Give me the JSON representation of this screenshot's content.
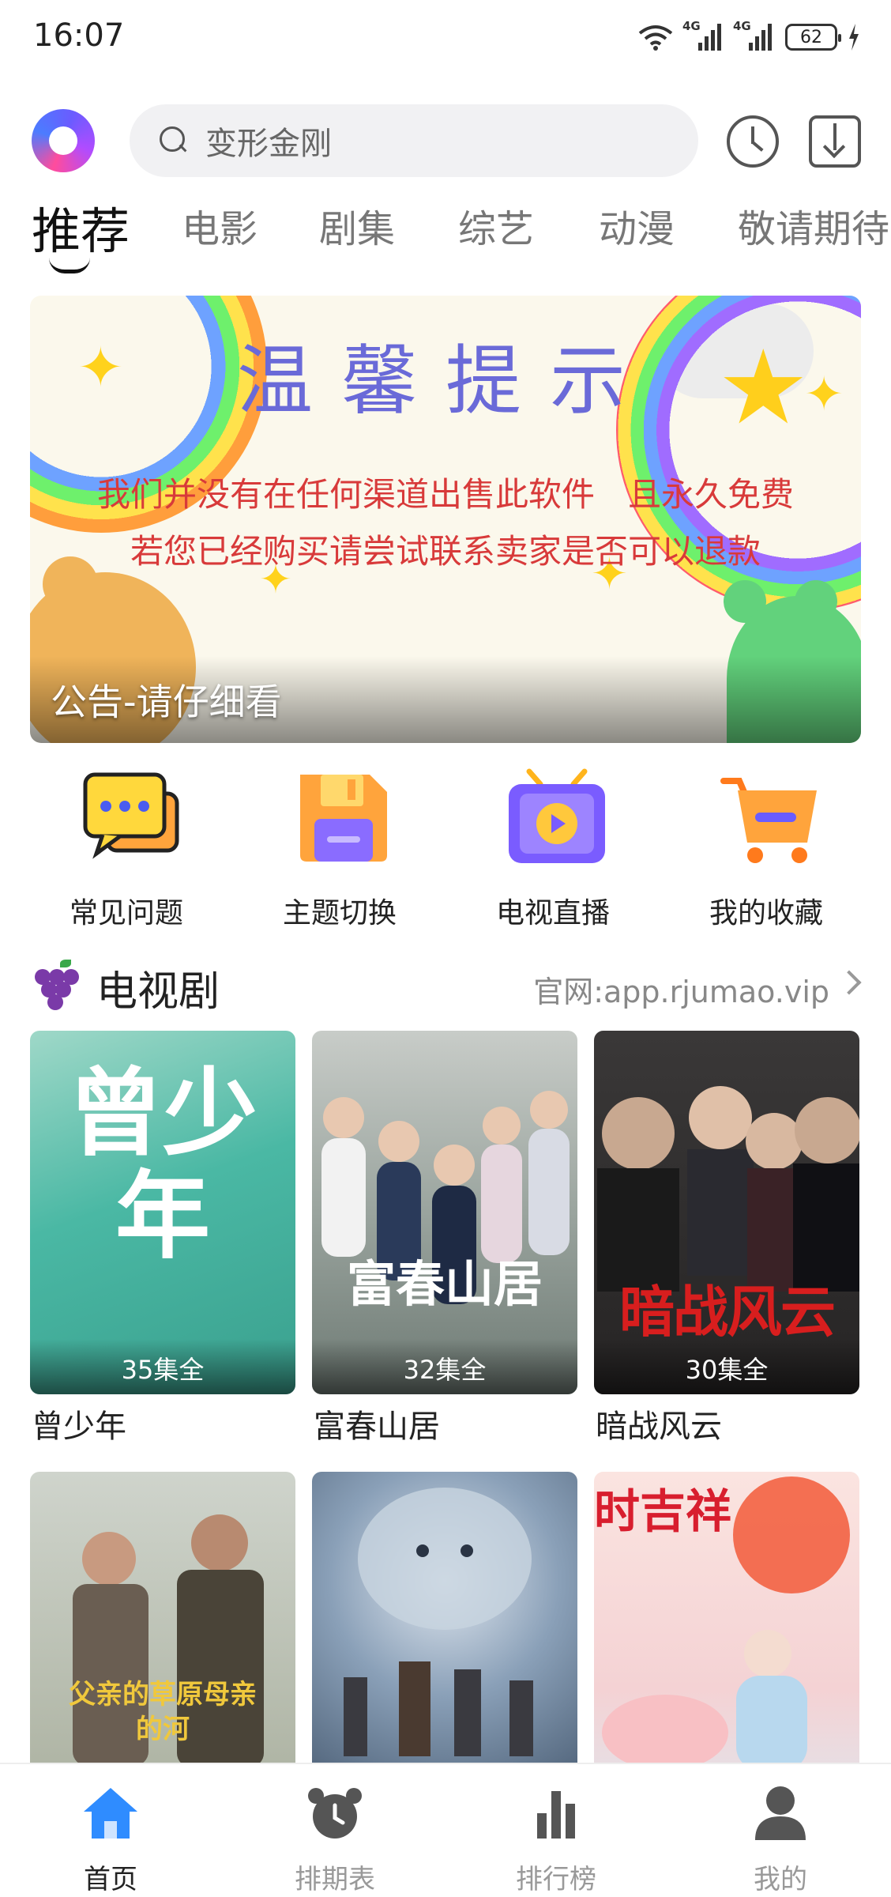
{
  "status_bar": {
    "time": "16:07",
    "network1": "4G",
    "network2": "4G",
    "battery": "62"
  },
  "header": {
    "search_placeholder": "变形金刚",
    "icons": [
      "app-logo",
      "search-icon",
      "history-clock-icon",
      "download-icon"
    ]
  },
  "tabs": [
    {
      "label": "推荐",
      "active": true
    },
    {
      "label": "电影"
    },
    {
      "label": "剧集"
    },
    {
      "label": "综艺"
    },
    {
      "label": "动漫"
    },
    {
      "label": "敬请期待"
    }
  ],
  "banner": {
    "title": "温馨提示",
    "line1": "我们并没有在任何渠道出售此软件　且永久免费",
    "line2": "若您已经购买请尝试联系卖家是否可以退款",
    "caption": "公告-请仔细看"
  },
  "quick_entries": [
    {
      "label": "常见问题",
      "icon": "chat-bubble-icon"
    },
    {
      "label": "主题切换",
      "icon": "floppy-save-icon"
    },
    {
      "label": "电视直播",
      "icon": "tv-play-icon"
    },
    {
      "label": "我的收藏",
      "icon": "shopping-cart-icon"
    }
  ],
  "section": {
    "title": "电视剧",
    "link": "官网:app.rjumao.vip"
  },
  "cards": [
    {
      "title": "曾少年",
      "badge": "35集全",
      "poster_text": "曾少年"
    },
    {
      "title": "富春山居",
      "badge": "32集全",
      "poster_text": "富春山居"
    },
    {
      "title": "暗战风云",
      "badge": "30集全",
      "poster_text": "暗战风云"
    },
    {
      "title": "",
      "badge": "",
      "poster_text": "父亲的草原母亲的河"
    },
    {
      "title": "",
      "badge": "",
      "poster_text": ""
    },
    {
      "title": "",
      "badge": "",
      "poster_text": "七时吉祥"
    }
  ],
  "bottom_nav": [
    {
      "label": "首页",
      "icon": "home-icon",
      "active": true
    },
    {
      "label": "排期表",
      "icon": "alarm-clock-icon"
    },
    {
      "label": "排行榜",
      "icon": "bar-chart-icon"
    },
    {
      "label": "我的",
      "icon": "user-icon"
    }
  ],
  "colors": {
    "accent_blue": "#2f8cff",
    "banner_title": "#6a6ad8",
    "banner_text": "#d83a3a"
  }
}
